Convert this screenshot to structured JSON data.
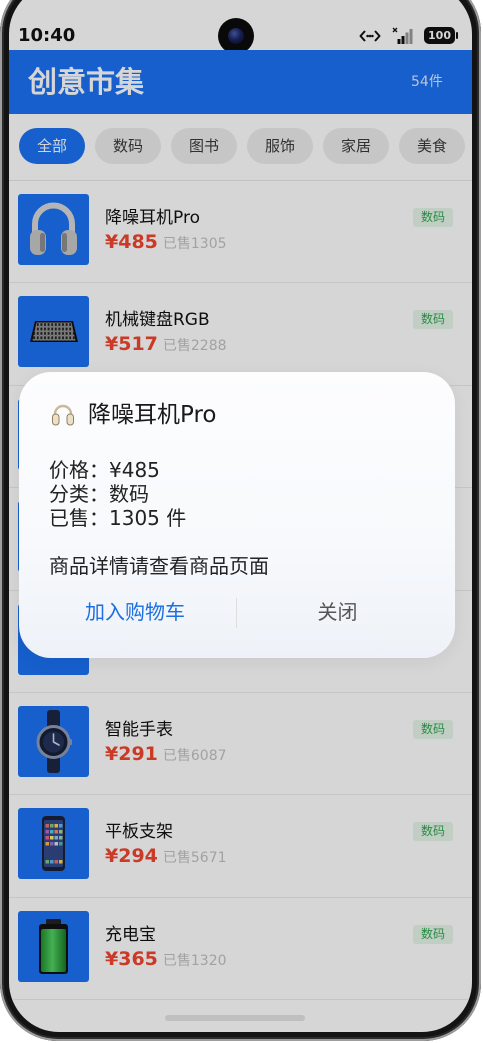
{
  "status_bar": {
    "time": "10:40",
    "battery_level": "100",
    "icons": [
      "data-sync-icon",
      "signal-icon",
      "battery-icon"
    ]
  },
  "header": {
    "title": "创意市集",
    "count": "54件"
  },
  "categories": [
    {
      "label": "全部",
      "selected": true
    },
    {
      "label": "数码",
      "selected": false
    },
    {
      "label": "图书",
      "selected": false
    },
    {
      "label": "服饰",
      "selected": false
    },
    {
      "label": "家居",
      "selected": false
    },
    {
      "label": "美食",
      "selected": false
    }
  ],
  "products": [
    {
      "name": "降噪耳机Pro",
      "price": "¥485",
      "sold": "已售1305",
      "tag": "数码",
      "icon": "headphones-icon"
    },
    {
      "name": "机械键盘RGB",
      "price": "¥517",
      "sold": "已售2288",
      "tag": "数码",
      "icon": "keyboard-icon"
    },
    {},
    {},
    {},
    {
      "name": "智能手表",
      "price": "¥291",
      "sold": "已售6087",
      "tag": "数码",
      "icon": "watch-icon"
    },
    {
      "name": "平板支架",
      "price": "¥294",
      "sold": "已售5671",
      "tag": "数码",
      "icon": "phone-icon"
    },
    {
      "name": "充电宝",
      "price": "¥365",
      "sold": "已售1320",
      "tag": "数码",
      "icon": "battery-icon"
    }
  ],
  "dialog": {
    "icon": "headphones-icon",
    "title": "降噪耳机Pro",
    "lines": [
      "价格：¥485",
      "分类：数码",
      "已售：1305 件"
    ],
    "note": "商品详情请查看商品页面",
    "confirm_label": "加入购物车",
    "cancel_label": "关闭"
  },
  "colors": {
    "accent": "#1b72f5",
    "price": "#f2442f",
    "tag_bg": "#e6f6e9",
    "tag_text": "#2fa552",
    "dialog_action": "#1c6fe3"
  }
}
